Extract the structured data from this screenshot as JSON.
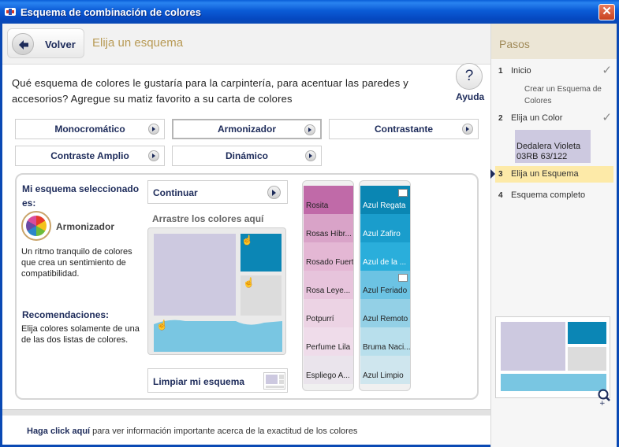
{
  "window": {
    "title": "Esquema de combinación de colores",
    "close_label": "✕"
  },
  "header": {
    "back_label": "Volver",
    "step_title": "Elija un esquema"
  },
  "question": "Qué esquema de colores le gustaría para la carpintería, para acentuar las paredes y accesorios? Agregue su matiz favorito a su carta de colores",
  "help": {
    "icon": "?",
    "label": "Ayuda"
  },
  "scheme_buttons": [
    {
      "label": "Monocromático"
    },
    {
      "label": "Armonizador"
    },
    {
      "label": "Contrastante"
    },
    {
      "label": "Contraste Amplio"
    },
    {
      "label": "Dinámico"
    }
  ],
  "selected_scheme_index": 1,
  "selection": {
    "title": "Mi esquema seleccionado es:",
    "name": "Armonizador",
    "description": "Un ritmo tranquilo de colores que crea un sentimiento de compatibilidad.",
    "reco_title": "Recomendaciones:",
    "reco_text": "Elija colores solamente de una de las dos listas de colores."
  },
  "continue_label": "Continuar",
  "drag_label": "Arrastre los colores aquí",
  "clear_label": "Limpiar mi esquema",
  "drop_colors": {
    "main": "#cdc9e0",
    "top_right": "#0b86b5",
    "mid_right": "#dcdcdc",
    "bottom": "#79c6e2"
  },
  "pink_column": [
    {
      "name": "Rosita",
      "color": "#c06aa8",
      "light": false
    },
    {
      "name": "Rosas Híbr...",
      "color": "#d9a3c8",
      "light": false
    },
    {
      "name": "Rosado Fuerte",
      "color": "#e4b7d4",
      "light": false
    },
    {
      "name": "Rosa Leye...",
      "color": "#e7c4dc",
      "light": false
    },
    {
      "name": "Potpurrí",
      "color": "#ecd3e4",
      "light": false
    },
    {
      "name": "Perfume Lila",
      "color": "#efdcea",
      "light": false
    },
    {
      "name": "Espliego A...",
      "color": "#eae4ec",
      "light": false
    }
  ],
  "blue_column": [
    {
      "name": "Azul Regata",
      "color": "#0a86b3",
      "light": true,
      "flag": true
    },
    {
      "name": "Azul Zafiro",
      "color": "#1a9dcc",
      "light": true,
      "flag": false
    },
    {
      "name": "Azul de la ...",
      "color": "#2aaedb",
      "light": true,
      "flag": false
    },
    {
      "name": "Azul Feriado",
      "color": "#6cc3e3",
      "light": false,
      "flag": true
    },
    {
      "name": "Azul Remoto",
      "color": "#93d0e6",
      "light": false,
      "flag": false
    },
    {
      "name": "Bruma Naci...",
      "color": "#b8dfec",
      "light": false,
      "flag": false
    },
    {
      "name": "Azul Limpio",
      "color": "#cfe6ee",
      "light": false,
      "flag": false
    }
  ],
  "pasos": {
    "title": "Pasos",
    "steps": [
      {
        "num": "1",
        "label": "Inicio",
        "done": true
      },
      {
        "num": "2",
        "label": "Elija un Color",
        "done": true
      },
      {
        "num": "3",
        "label": "Elija un Esquema",
        "done": false
      },
      {
        "num": "4",
        "label": "Esquema completo",
        "done": false
      }
    ],
    "create_link": "Crear un Esquema de Colores",
    "chosen_color": "Dedalera Violeta 03RB 63/122",
    "check": "✓"
  },
  "footer": {
    "link": "Haga click aquí",
    "text": " para ver información importante acerca de la exactitud de los colores"
  },
  "colors": {
    "navy": "#1d2b5a",
    "gold": "#b89a55",
    "title_blue": "#0b5bd6"
  }
}
